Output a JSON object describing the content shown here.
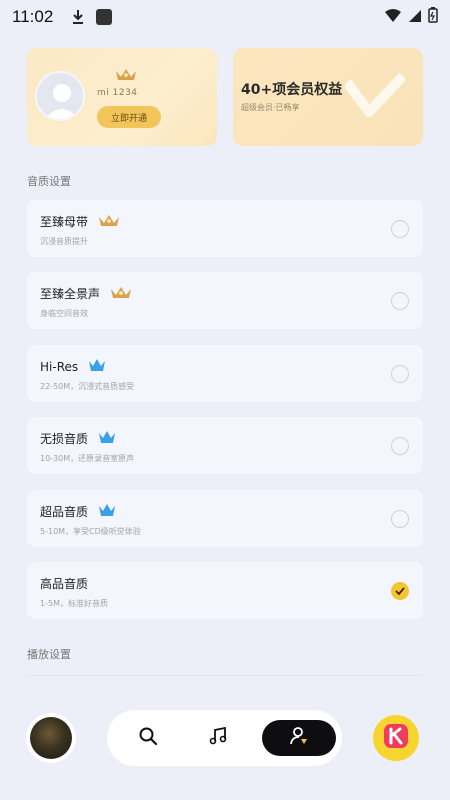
{
  "status_bar": {
    "time": "11:02",
    "icons": [
      "download-icon",
      "app-icon",
      "wifi-icon",
      "signal-icon",
      "battery-icon"
    ]
  },
  "profile_card": {
    "username": "mi 1234",
    "open_button_label": "立即开通"
  },
  "benefit_card": {
    "title": "40+项会员权益",
    "subtitle": "超级会员·已畅享"
  },
  "sound_quality_section": {
    "label": "音质设置",
    "items": [
      {
        "title": "至臻母带",
        "desc": "沉浸音质提升",
        "badge": "gold",
        "selected": false
      },
      {
        "title": "至臻全景声",
        "desc": "身临空间音效",
        "badge": "gold",
        "selected": false
      },
      {
        "title": "Hi-Res",
        "desc": "22-50M，沉浸式音质感受",
        "badge": "blue",
        "selected": false
      },
      {
        "title": "无损音质",
        "desc": "10-30M，还原录音室原声",
        "badge": "blue",
        "selected": false
      },
      {
        "title": "超品音质",
        "desc": "5-10M，享受CD级听觉体验",
        "badge": "blue",
        "selected": false
      },
      {
        "title": "高品音质",
        "desc": "1-5M，标准好音质",
        "badge": "none",
        "selected": true
      }
    ]
  },
  "playback_section": {
    "label": "播放设置"
  },
  "bottom_nav": {
    "items": [
      "search-icon",
      "music-note-icon",
      "profile-icon"
    ],
    "active": "profile-icon"
  },
  "colors": {
    "background": "#eceef8",
    "accent": "#f4c531",
    "card_gold": "#fbe9c4"
  }
}
